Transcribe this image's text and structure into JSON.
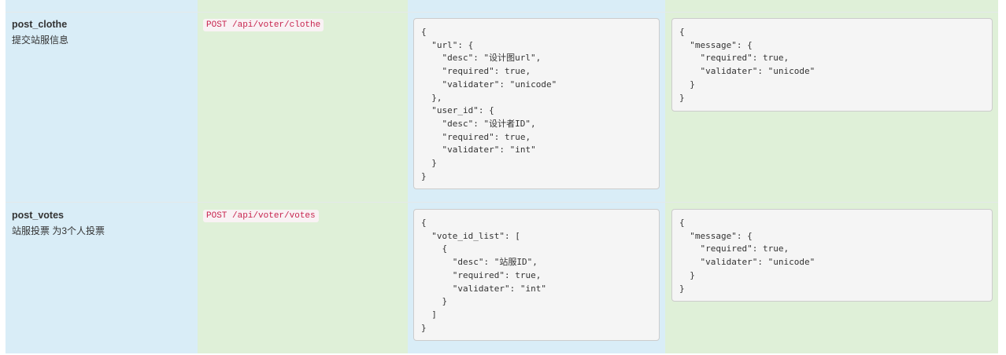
{
  "rows": [
    {
      "name": "post_clothe",
      "description": "提交站服信息",
      "route": "POST /api/voter/clothe",
      "params": "{\n  \"url\": {\n    \"desc\": \"设计图url\",\n    \"required\": true,\n    \"validater\": \"unicode\"\n  },\n  \"user_id\": {\n    \"desc\": \"设计者ID\",\n    \"required\": true,\n    \"validater\": \"int\"\n  }\n}",
      "response": "{\n  \"message\": {\n    \"required\": true,\n    \"validater\": \"unicode\"\n  }\n}"
    },
    {
      "name": "post_votes",
      "description": "站服投票 为3个人投票",
      "route": "POST /api/voter/votes",
      "params": "{\n  \"vote_id_list\": [\n    {\n      \"desc\": \"站服ID\",\n      \"required\": true,\n      \"validater\": \"int\"\n    }\n  ]\n}",
      "response": "{\n  \"message\": {\n    \"required\": true,\n    \"validater\": \"unicode\"\n  }\n}"
    }
  ]
}
